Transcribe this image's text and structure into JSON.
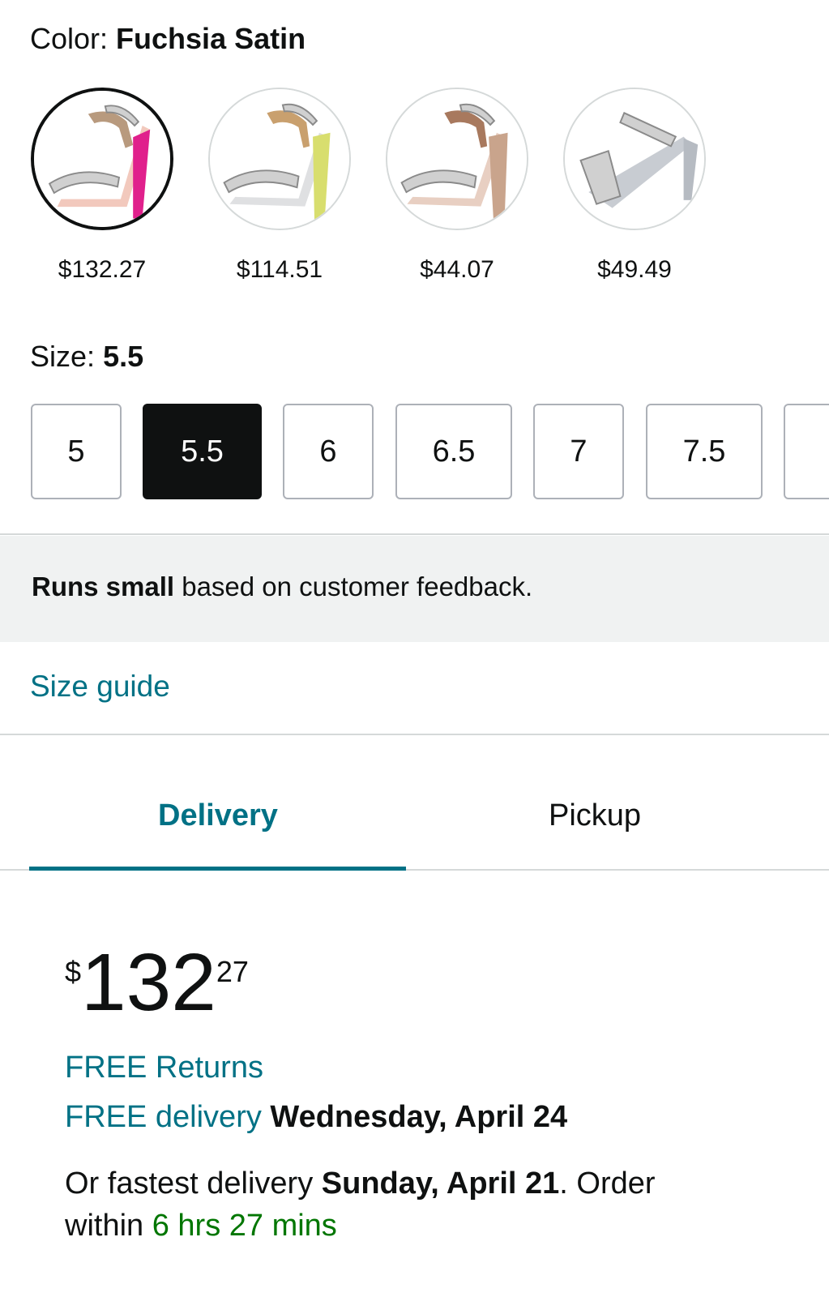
{
  "color": {
    "label": "Color:",
    "selected_name": "Fuchsia Satin",
    "swatches": [
      {
        "name": "fuchsia",
        "price": "$132.27",
        "selected": true,
        "tone": "#e0208c"
      },
      {
        "name": "yellow",
        "price": "$114.51",
        "selected": false,
        "tone": "#d8de6e"
      },
      {
        "name": "rose-gold",
        "price": "$44.07",
        "selected": false,
        "tone": "#c9a48c"
      },
      {
        "name": "silver",
        "price": "$49.49",
        "selected": false,
        "tone": "#c8ccd2"
      }
    ]
  },
  "size": {
    "label": "Size:",
    "selected": "5.5",
    "options": [
      "5",
      "5.5",
      "6",
      "6.5",
      "7",
      "7.5"
    ]
  },
  "fit_note": {
    "bold": "Runs small",
    "rest": " based on customer feedback."
  },
  "size_guide_label": "Size guide",
  "tabs": {
    "delivery": "Delivery",
    "pickup": "Pickup"
  },
  "price": {
    "symbol": "$",
    "whole": "132",
    "fraction": "27"
  },
  "returns": "FREE Returns",
  "free_delivery": {
    "prefix": "FREE delivery",
    "date": "Wednesday, April 24"
  },
  "fastest_delivery": {
    "prefix": "Or fastest delivery ",
    "date": "Sunday, April 21",
    "mid": ". Order",
    "within": "within ",
    "countdown": "6 hrs 27 mins"
  },
  "colors": {
    "link": "#007185",
    "countdown": "#007600",
    "text": "#0f1111"
  }
}
